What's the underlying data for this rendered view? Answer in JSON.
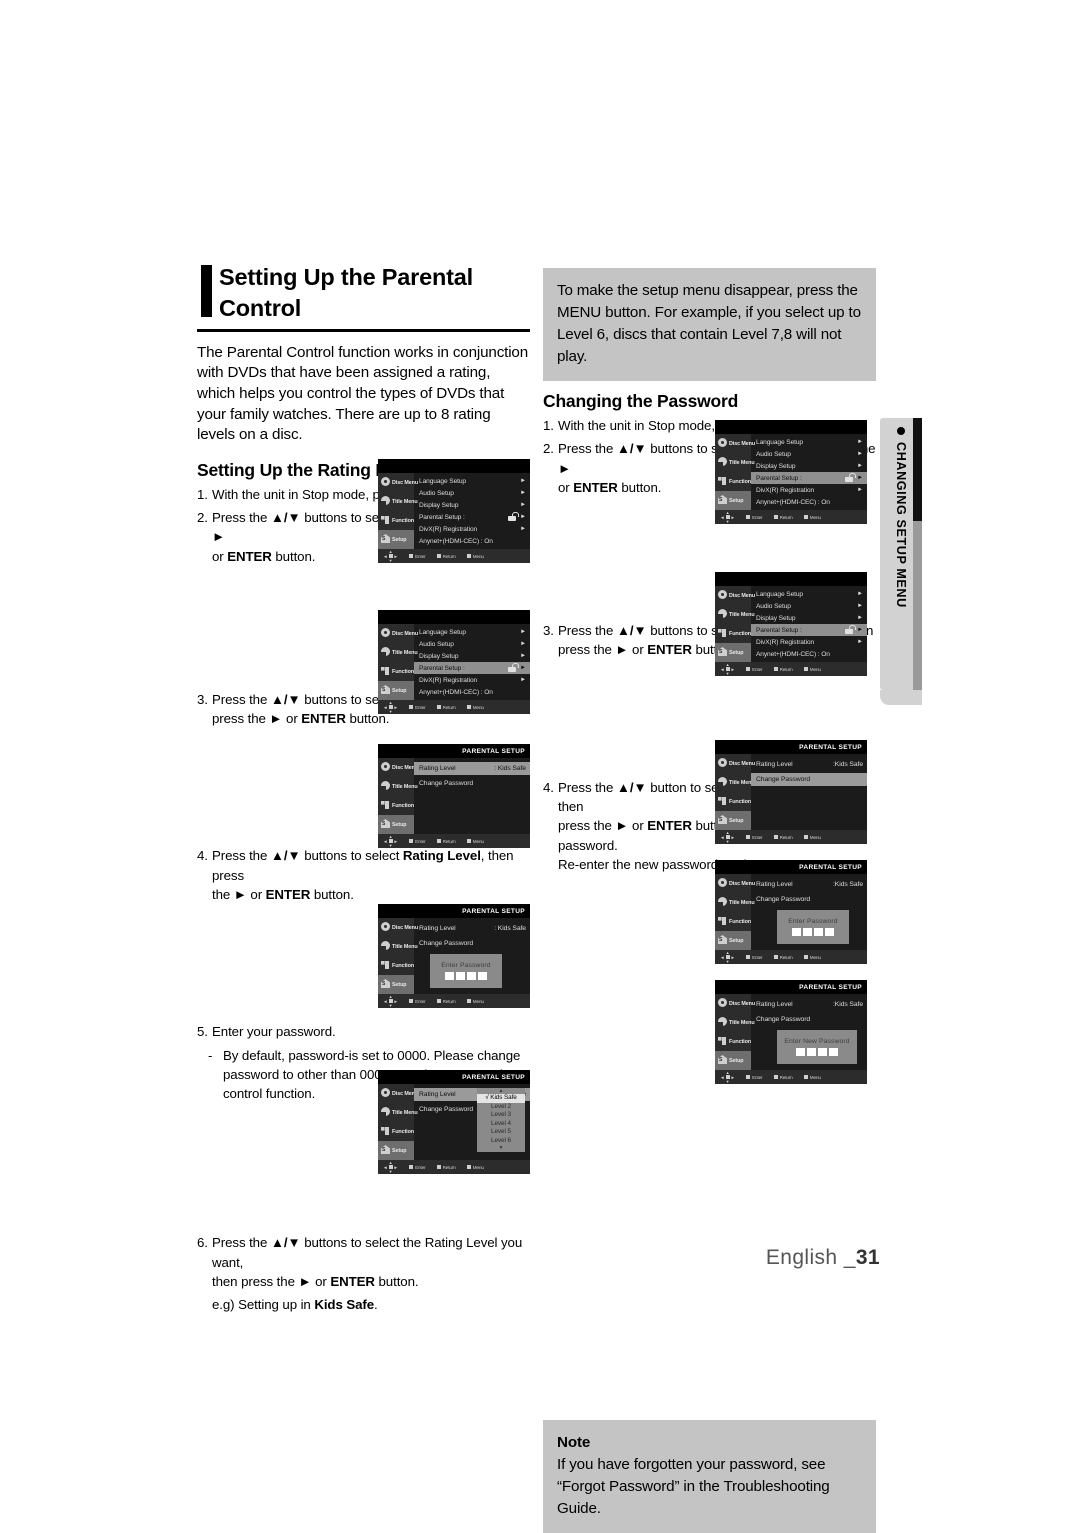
{
  "page": {
    "footer_label": "English _",
    "footer_number": "31"
  },
  "side_tab": {
    "label": "CHANGING SETUP MENU",
    "bullet": "bullet-dot"
  },
  "left_column": {
    "title": "Setting Up the Parental Control",
    "intro": "The Parental Control function works in conjunction with DVDs that have been assigned a rating, which helps you control the types of DVDs that your family watches. There are up to 8 rating levels on a disc.",
    "subtitle": "Setting Up the Rating Level",
    "steps": [
      {
        "num": "1.",
        "text": "With the unit in Stop mode, press the MENU button."
      },
      {
        "num": "2.",
        "text": "Press the ▲/▼ buttons to select Setup, then press the ► or ENTER button."
      },
      {
        "num": "3.",
        "text": "Press the ▲/▼ buttons to select Parental Setup, then press the ► or ENTER button."
      },
      {
        "num": "4.",
        "text": "Press the ▲/▼ buttons to select Rating Level, then press the ► or ENTER button."
      },
      {
        "num": "5.",
        "text": "Enter your password."
      },
      {
        "num": "-",
        "text": "By default, password-is set to 0000. Please change password to other than 0000 to activate parental control function."
      },
      {
        "num": "6.",
        "text": "Press the ▲/▼ buttons to select the Rating Level you want, then press the ► or ENTER button."
      },
      {
        "num": "",
        "text": "e.g) Setting up in Kids Safe."
      }
    ]
  },
  "right_column": {
    "top_note": "To make the setup menu disappear, press the MENU button. For example, if you select up to Level 6, discs that contain Level 7,8 will not play.",
    "subtitle": "Changing the Password",
    "steps": [
      {
        "num": "1.",
        "text": "With the unit in Stop mode, press the MENU button."
      },
      {
        "num": "2.",
        "text": "Press the ▲/▼ buttons to select Setup, then press the ► or ENTER button."
      },
      {
        "num": "3.",
        "text": "Press the ▲/▼ buttons to select Parental Setup, then press the ► or ENTER button."
      },
      {
        "num": "4.",
        "text": "Press the ▲/▼ button to select Change Password, then press the ► or ENTER button. Enter your new password. Re-enter the new password again."
      }
    ],
    "note": {
      "label": "Note",
      "text": "If you have forgotten your password, see “Forgot Password” in the Troubleshooting Guide."
    }
  },
  "osd": {
    "sidebar": [
      {
        "label": "Disc Menu",
        "icon": "disc-menu-icon"
      },
      {
        "label": "Title Menu",
        "icon": "title-menu-icon"
      },
      {
        "label": "Function",
        "icon": "function-icon"
      },
      {
        "label": "Setup",
        "icon": "setup-icon"
      }
    ],
    "bottom_bar": [
      {
        "label": "Enter",
        "icon": "enter-button-icon"
      },
      {
        "label": "Return",
        "icon": "return-button-icon"
      },
      {
        "label": "Menu",
        "icon": "menu-button-icon"
      }
    ],
    "setup_menu": {
      "rows": [
        {
          "label": "Language Setup",
          "arrow": "►",
          "value": ""
        },
        {
          "label": "Audio Setup",
          "arrow": "►",
          "value": ""
        },
        {
          "label": "Display Setup",
          "arrow": "►",
          "value": ""
        },
        {
          "label": "Parental Setup :",
          "arrow": "►",
          "value": "",
          "lock": true
        },
        {
          "label": "DivX(R) Registration",
          "arrow": "►",
          "value": ""
        },
        {
          "label": "Anynet+(HDMI-CEC) : On",
          "arrow": "",
          "value": ""
        }
      ]
    },
    "parental": {
      "title": "PARENTAL SETUP",
      "rating_label": "Rating Level",
      "rating_value": ": Kids Safe",
      "rating_value_tight": ":Kids Safe",
      "change_password": "Change Password",
      "enter_password": "Enter Password",
      "enter_new_password": "Enter New Password",
      "rating_options": [
        "√ Kids Safe",
        "Level 2",
        "Level 3",
        "Level 4",
        "Level 5",
        "Level 6"
      ]
    }
  }
}
